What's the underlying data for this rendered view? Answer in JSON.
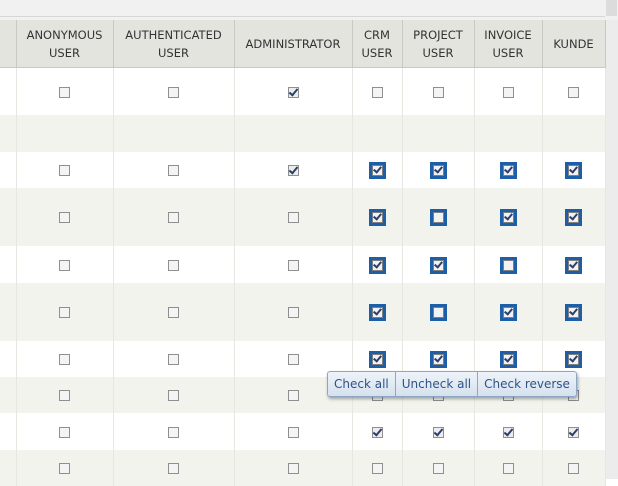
{
  "columns": [
    {
      "line1": "ANONYMOUS",
      "line2": "USER"
    },
    {
      "line1": "AUTHENTICATED",
      "line2": "USER"
    },
    {
      "line1": "ADMINISTRATOR",
      "line2": ""
    },
    {
      "line1": "CRM",
      "line2": "USER"
    },
    {
      "line1": "PROJECT",
      "line2": "USER"
    },
    {
      "line1": "INVOICE",
      "line2": "USER"
    },
    {
      "line1": "KUNDE",
      "line2": ""
    }
  ],
  "rows": [
    {
      "checks": [
        false,
        false,
        true,
        false,
        false,
        false,
        false
      ],
      "highlighted": false
    },
    {
      "checks": null,
      "highlighted": false
    },
    {
      "checks": [
        false,
        false,
        true,
        true,
        true,
        true,
        true
      ],
      "highlighted": true
    },
    {
      "checks": [
        false,
        false,
        false,
        true,
        false,
        true,
        true
      ],
      "highlighted": true
    },
    {
      "checks": [
        false,
        false,
        false,
        true,
        true,
        false,
        true
      ],
      "highlighted": true
    },
    {
      "checks": [
        false,
        false,
        false,
        true,
        false,
        true,
        true
      ],
      "highlighted": true
    },
    {
      "checks": [
        false,
        false,
        false,
        true,
        true,
        true,
        true
      ],
      "highlighted": true
    },
    {
      "checks": [
        false,
        false,
        false,
        false,
        false,
        false,
        false
      ],
      "highlighted": false
    },
    {
      "checks": [
        false,
        false,
        false,
        true,
        true,
        true,
        true
      ],
      "highlighted": false
    },
    {
      "checks": [
        false,
        false,
        false,
        false,
        false,
        false,
        false
      ],
      "highlighted": false
    }
  ],
  "popup": {
    "check_all": "Check all",
    "uncheck_all": "Uncheck all",
    "check_reverse": "Check reverse"
  }
}
